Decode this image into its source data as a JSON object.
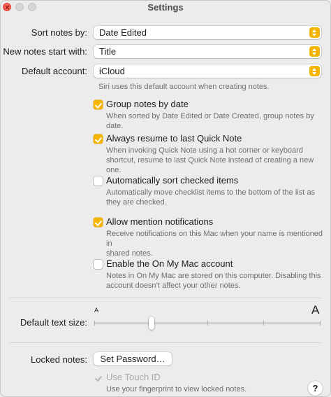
{
  "window": {
    "title": "Settings"
  },
  "sort_notes": {
    "label": "Sort notes by:",
    "value": "Date Edited"
  },
  "new_notes": {
    "label": "New notes start with:",
    "value": "Title"
  },
  "default_account": {
    "label": "Default account:",
    "value": "iCloud",
    "help": "Siri uses this default account when creating notes."
  },
  "options": [
    {
      "label": "Group notes by date",
      "checked": true,
      "desc": [
        "When sorted by Date Edited or Date Created, group notes by date."
      ]
    },
    {
      "label": "Always resume to last Quick Note",
      "checked": true,
      "desc": [
        "When invoking Quick Note using a hot corner or keyboard",
        "shortcut, resume to last Quick Note instead of creating a new one."
      ]
    },
    {
      "label": "Automatically sort checked items",
      "checked": false,
      "desc": [
        "Automatically move checklist items to the bottom of the list as",
        "they are checked."
      ]
    },
    {
      "label": "Allow mention notifications",
      "checked": true,
      "desc": [
        "Receive notifications on this Mac when your name is mentioned in",
        "shared notes."
      ]
    },
    {
      "label": "Enable the On My Mac account",
      "checked": false,
      "desc": [
        "Notes in On My Mac are stored on this computer. Disabling this",
        "account doesn’t affect your other notes."
      ]
    }
  ],
  "text_size": {
    "label": "Default text size:",
    "small_glyph": "A",
    "large_glyph": "A",
    "level": 0.25
  },
  "locked_notes": {
    "label": "Locked notes:",
    "button": "Set Password…",
    "touch_id_label": "Use Touch ID",
    "touch_id_checked": true,
    "touch_id_desc": "Use your fingerprint to view locked notes."
  },
  "help_button": "?",
  "colors": {
    "accent": "#f4b400",
    "close": "#ff5f57"
  }
}
